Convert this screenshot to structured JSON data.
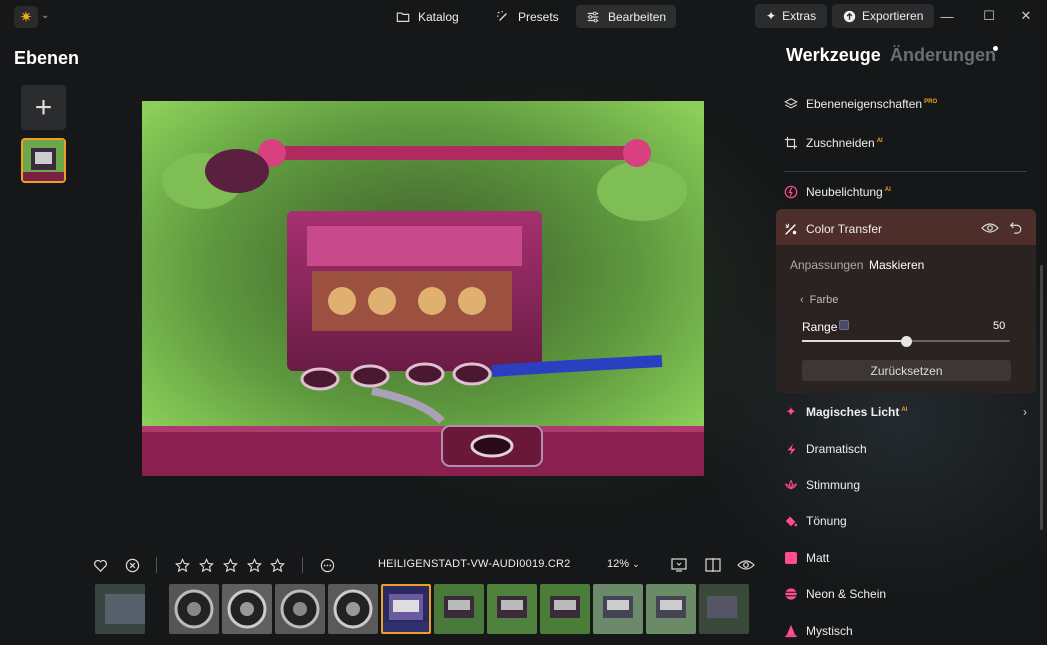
{
  "topbar": {
    "nav": [
      {
        "label": "Katalog"
      },
      {
        "label": "Presets"
      },
      {
        "label": "Bearbeiten"
      }
    ],
    "extras_label": "Extras",
    "export_label": "Exportieren"
  },
  "left_panel": {
    "title": "Ebenen",
    "add_symbol": "+"
  },
  "bottom_bar": {
    "filename": "HEILIGENSTADT-VW-AUDI0019.CR2",
    "zoom": "12%"
  },
  "right_panel": {
    "tab_tools": "Werkzeuge",
    "tab_changes": "Änderungen",
    "tools_top": [
      {
        "label": "Ebeneneigenschaften",
        "badge": "PRO",
        "icon": "layers-icon"
      },
      {
        "label": "Zuschneiden",
        "badge": "AI",
        "icon": "crop-icon"
      }
    ],
    "relight": {
      "label": "Neubelichtung",
      "badge": "AI"
    },
    "color_transfer": {
      "label": "Color Transfer",
      "subtab_adjust": "Anpassungen",
      "subtab_mask": "Maskieren",
      "back_label": "Farbe",
      "range_label": "Range",
      "range_value": "50",
      "range_fraction": 0.5,
      "reset_label": "Zurücksetzen"
    },
    "creative_tools": [
      {
        "label": "Magisches Licht",
        "badge": "AI",
        "icon": "sparkle-icon"
      },
      {
        "label": "Dramatisch",
        "badge": "",
        "icon": "lightning-icon"
      },
      {
        "label": "Stimmung",
        "badge": "",
        "icon": "lotus-icon"
      },
      {
        "label": "Tönung",
        "badge": "",
        "icon": "paint-bucket-icon"
      },
      {
        "label": "Matt",
        "badge": "",
        "icon": "square-icon"
      },
      {
        "label": "Neon & Schein",
        "badge": "",
        "icon": "neon-sphere-icon"
      },
      {
        "label": "Mystisch",
        "badge": "",
        "icon": "cone-icon"
      }
    ]
  },
  "colors": {
    "accent": "#f0a020",
    "pink_icon": "#ff4d8d",
    "ct_header": "#4d2e2a"
  }
}
